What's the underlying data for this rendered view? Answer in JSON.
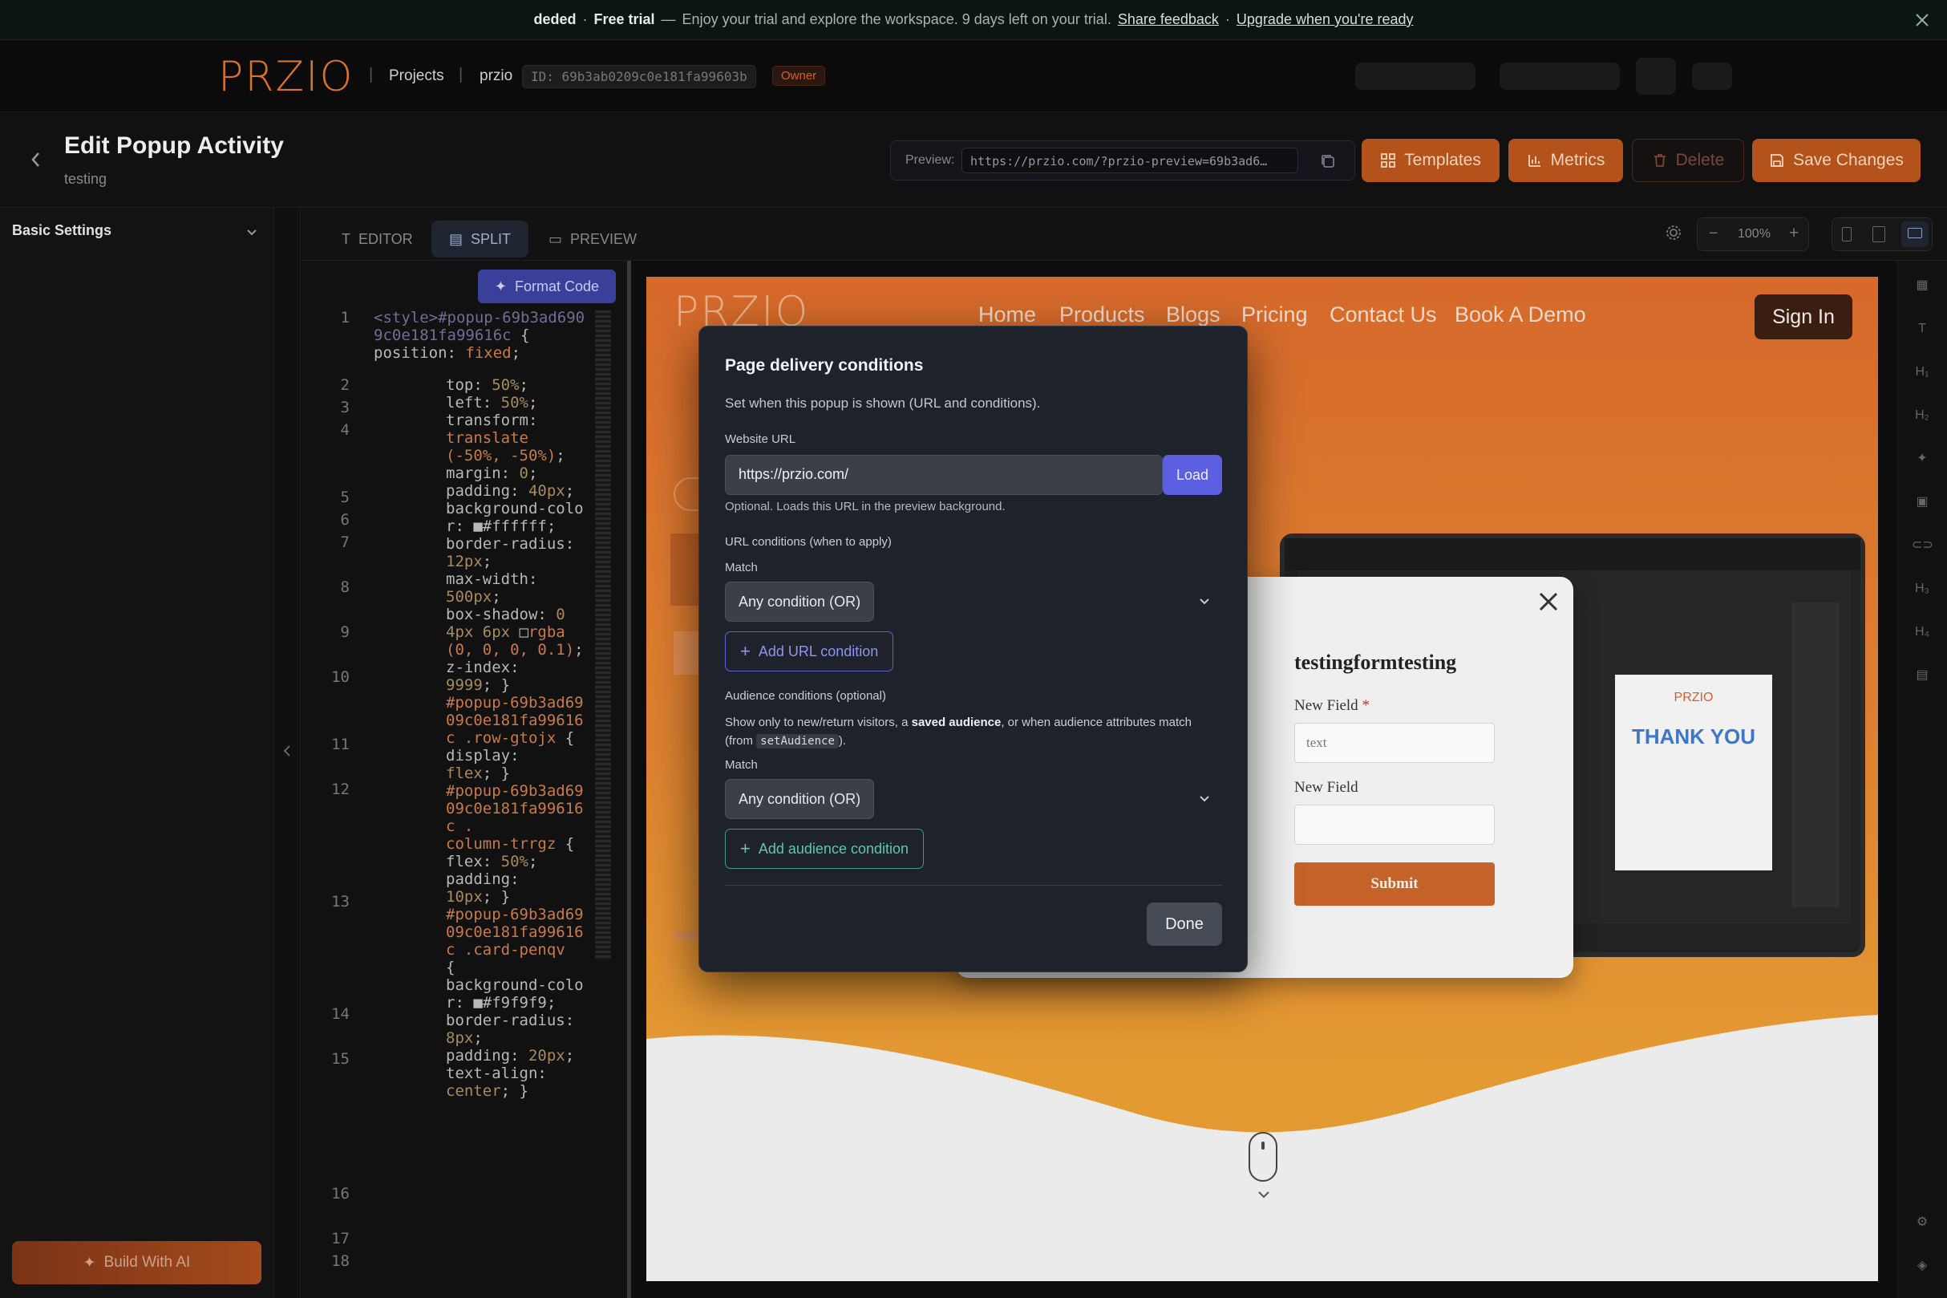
{
  "banner": {
    "brand": "deded",
    "plan": "Free trial",
    "dash": "—",
    "message": "Enjoy your trial and explore the workspace. 9 days left on your trial.",
    "feedback_link": "Share feedback",
    "dot": "·",
    "upgrade_link": "Upgrade when you're ready"
  },
  "topnav": {
    "logo": "PRZIO",
    "projects": "Projects",
    "project_name": "przio",
    "project_id": "ID: 69b3ab0209c0e181fa99603b",
    "role": "Owner"
  },
  "header": {
    "title": "Edit Popup Activity",
    "subtitle": "testing",
    "preview_label": "Preview:",
    "preview_url": "https://przio.com/?przio-preview=69b3ad6…",
    "templates": "Templates",
    "metrics": "Metrics",
    "delete": "Delete",
    "save": "Save Changes"
  },
  "sidebar": {
    "section": "Basic Settings",
    "build_ai": "Build With AI"
  },
  "toolbar": {
    "tabs": [
      "EDITOR",
      "SPLIT",
      "PREVIEW"
    ],
    "zoom": "100%"
  },
  "code": {
    "format_button": "Format Code",
    "line_numbers": [
      "1",
      "2",
      "3",
      "4",
      "5",
      "6",
      "7",
      "8",
      "9",
      "10",
      "11",
      "12",
      "13",
      "14",
      "15",
      "16",
      "17",
      "18"
    ]
  },
  "site": {
    "logo": "PRZIO",
    "nav": [
      "Home",
      "Products",
      "Blogs",
      "Pricing",
      "Contact Us",
      "Book A Demo"
    ],
    "signin": "Sign In"
  },
  "inner_popup": {
    "title": "testingformtesting",
    "field1_label": "New Field",
    "required_mark": "*",
    "field1_placeholder": "text",
    "field2_label": "New Field",
    "submit": "Submit",
    "laptop_card_logo": "PRZIO",
    "laptop_card_heading": "THANK YOU"
  },
  "modal": {
    "title": "Page delivery conditions",
    "subtitle": "Set when this popup is shown (URL and conditions).",
    "website_url_label": "Website URL",
    "website_url_value": "https://przio.com/",
    "load": "Load",
    "url_hint": "Optional. Loads this URL in the preview background.",
    "url_conditions_label": "URL conditions (when to apply)",
    "match_label": "Match",
    "url_match_value": "Any condition (OR)",
    "add_url_condition": "Add URL condition",
    "audience_label": "Audience conditions (optional)",
    "audience_desc_1": "Show only to new/return visitors, a ",
    "audience_desc_bold": "saved audience",
    "audience_desc_2": ", or when audience attributes match (from ",
    "audience_desc_code": "setAudience",
    "audience_desc_3": ").",
    "audience_match_label": "Match",
    "audience_match_value": "Any condition (OR)",
    "add_audience_condition": "Add audience condition",
    "done": "Done"
  },
  "colors": {
    "accent_orange": "#b3521a",
    "modal_bg": "#1e232b",
    "load_button": "#5b5fe0",
    "audience_teal": "#5fc7b0"
  }
}
